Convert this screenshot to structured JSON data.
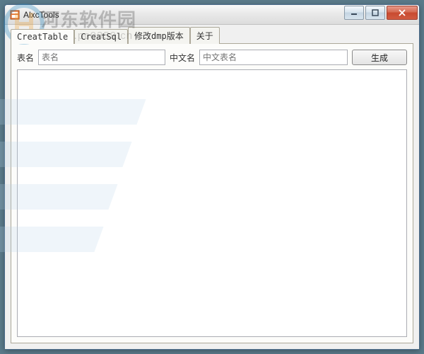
{
  "window": {
    "title": "AlxcTools"
  },
  "tabs": [
    {
      "label": "CreatTable",
      "active": true
    },
    {
      "label": "CreatSql",
      "active": false
    },
    {
      "label": "修改dmp版本",
      "active": false
    },
    {
      "label": "关于",
      "active": false
    }
  ],
  "form": {
    "name_label": "表名",
    "name_placeholder": "表名",
    "cname_label": "中文名",
    "cname_placeholder": "中文表名",
    "generate_label": "生成"
  },
  "watermark": {
    "brand": "河东软件园",
    "url": "www.pc0359.cn"
  },
  "icons": {
    "app": "app-icon",
    "minimize": "minimize-icon",
    "maximize": "maximize-icon",
    "close": "close-icon"
  }
}
